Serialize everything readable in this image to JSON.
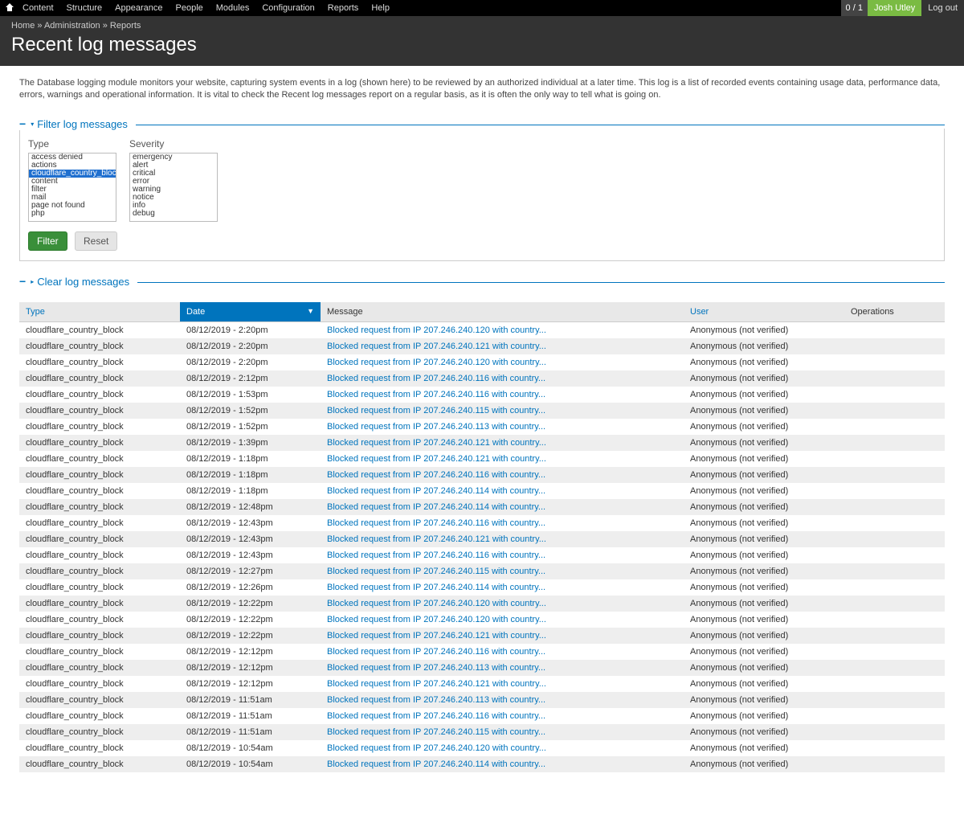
{
  "toolbar": {
    "menu": [
      "Content",
      "Structure",
      "Appearance",
      "People",
      "Modules",
      "Configuration",
      "Reports",
      "Help"
    ],
    "counter": "0 / 1",
    "user": "Josh Utley",
    "logout": "Log out"
  },
  "breadcrumb": {
    "parts": [
      "Home",
      "Administration",
      "Reports"
    ]
  },
  "page_title": "Recent log messages",
  "description": "The Database logging module monitors your website, capturing system events in a log (shown here) to be reviewed by an authorized individual at a later time. This log is a list of recorded events containing usage data, performance data, errors, warnings and operational information. It is vital to check the Recent log messages report on a regular basis, as it is often the only way to tell what is going on.",
  "filter": {
    "legend": "Filter log messages",
    "type_label": "Type",
    "severity_label": "Severity",
    "types": [
      "access denied",
      "actions",
      "cloudflare_country_block",
      "content",
      "filter",
      "mail",
      "page not found",
      "php"
    ],
    "type_selected_index": 2,
    "severities": [
      "emergency",
      "alert",
      "critical",
      "error",
      "warning",
      "notice",
      "info",
      "debug"
    ],
    "filter_btn": "Filter",
    "reset_btn": "Reset"
  },
  "clear_legend": "Clear log messages",
  "columns": {
    "type": "Type",
    "date": "Date",
    "message": "Message",
    "user": "User",
    "operations": "Operations",
    "sort_column": "date",
    "sort_dir": "desc"
  },
  "rows": [
    {
      "type": "cloudflare_country_block",
      "date": "08/12/2019 - 2:20pm",
      "msg": "Blocked request from IP 207.246.240.120 with country...",
      "user": "Anonymous (not verified)"
    },
    {
      "type": "cloudflare_country_block",
      "date": "08/12/2019 - 2:20pm",
      "msg": "Blocked request from IP 207.246.240.121 with country...",
      "user": "Anonymous (not verified)"
    },
    {
      "type": "cloudflare_country_block",
      "date": "08/12/2019 - 2:20pm",
      "msg": "Blocked request from IP 207.246.240.120 with country...",
      "user": "Anonymous (not verified)"
    },
    {
      "type": "cloudflare_country_block",
      "date": "08/12/2019 - 2:12pm",
      "msg": "Blocked request from IP 207.246.240.116 with country...",
      "user": "Anonymous (not verified)"
    },
    {
      "type": "cloudflare_country_block",
      "date": "08/12/2019 - 1:53pm",
      "msg": "Blocked request from IP 207.246.240.116 with country...",
      "user": "Anonymous (not verified)"
    },
    {
      "type": "cloudflare_country_block",
      "date": "08/12/2019 - 1:52pm",
      "msg": "Blocked request from IP 207.246.240.115 with country...",
      "user": "Anonymous (not verified)"
    },
    {
      "type": "cloudflare_country_block",
      "date": "08/12/2019 - 1:52pm",
      "msg": "Blocked request from IP 207.246.240.113 with country...",
      "user": "Anonymous (not verified)"
    },
    {
      "type": "cloudflare_country_block",
      "date": "08/12/2019 - 1:39pm",
      "msg": "Blocked request from IP 207.246.240.121 with country...",
      "user": "Anonymous (not verified)"
    },
    {
      "type": "cloudflare_country_block",
      "date": "08/12/2019 - 1:18pm",
      "msg": "Blocked request from IP 207.246.240.121 with country...",
      "user": "Anonymous (not verified)"
    },
    {
      "type": "cloudflare_country_block",
      "date": "08/12/2019 - 1:18pm",
      "msg": "Blocked request from IP 207.246.240.116 with country...",
      "user": "Anonymous (not verified)"
    },
    {
      "type": "cloudflare_country_block",
      "date": "08/12/2019 - 1:18pm",
      "msg": "Blocked request from IP 207.246.240.114 with country...",
      "user": "Anonymous (not verified)"
    },
    {
      "type": "cloudflare_country_block",
      "date": "08/12/2019 - 12:48pm",
      "msg": "Blocked request from IP 207.246.240.114 with country...",
      "user": "Anonymous (not verified)"
    },
    {
      "type": "cloudflare_country_block",
      "date": "08/12/2019 - 12:43pm",
      "msg": "Blocked request from IP 207.246.240.116 with country...",
      "user": "Anonymous (not verified)"
    },
    {
      "type": "cloudflare_country_block",
      "date": "08/12/2019 - 12:43pm",
      "msg": "Blocked request from IP 207.246.240.121 with country...",
      "user": "Anonymous (not verified)"
    },
    {
      "type": "cloudflare_country_block",
      "date": "08/12/2019 - 12:43pm",
      "msg": "Blocked request from IP 207.246.240.116 with country...",
      "user": "Anonymous (not verified)"
    },
    {
      "type": "cloudflare_country_block",
      "date": "08/12/2019 - 12:27pm",
      "msg": "Blocked request from IP 207.246.240.115 with country...",
      "user": "Anonymous (not verified)"
    },
    {
      "type": "cloudflare_country_block",
      "date": "08/12/2019 - 12:26pm",
      "msg": "Blocked request from IP 207.246.240.114 with country...",
      "user": "Anonymous (not verified)"
    },
    {
      "type": "cloudflare_country_block",
      "date": "08/12/2019 - 12:22pm",
      "msg": "Blocked request from IP 207.246.240.120 with country...",
      "user": "Anonymous (not verified)"
    },
    {
      "type": "cloudflare_country_block",
      "date": "08/12/2019 - 12:22pm",
      "msg": "Blocked request from IP 207.246.240.120 with country...",
      "user": "Anonymous (not verified)"
    },
    {
      "type": "cloudflare_country_block",
      "date": "08/12/2019 - 12:22pm",
      "msg": "Blocked request from IP 207.246.240.121 with country...",
      "user": "Anonymous (not verified)"
    },
    {
      "type": "cloudflare_country_block",
      "date": "08/12/2019 - 12:12pm",
      "msg": "Blocked request from IP 207.246.240.116 with country...",
      "user": "Anonymous (not verified)"
    },
    {
      "type": "cloudflare_country_block",
      "date": "08/12/2019 - 12:12pm",
      "msg": "Blocked request from IP 207.246.240.113 with country...",
      "user": "Anonymous (not verified)"
    },
    {
      "type": "cloudflare_country_block",
      "date": "08/12/2019 - 12:12pm",
      "msg": "Blocked request from IP 207.246.240.121 with country...",
      "user": "Anonymous (not verified)"
    },
    {
      "type": "cloudflare_country_block",
      "date": "08/12/2019 - 11:51am",
      "msg": "Blocked request from IP 207.246.240.113 with country...",
      "user": "Anonymous (not verified)"
    },
    {
      "type": "cloudflare_country_block",
      "date": "08/12/2019 - 11:51am",
      "msg": "Blocked request from IP 207.246.240.116 with country...",
      "user": "Anonymous (not verified)"
    },
    {
      "type": "cloudflare_country_block",
      "date": "08/12/2019 - 11:51am",
      "msg": "Blocked request from IP 207.246.240.115 with country...",
      "user": "Anonymous (not verified)"
    },
    {
      "type": "cloudflare_country_block",
      "date": "08/12/2019 - 10:54am",
      "msg": "Blocked request from IP 207.246.240.120 with country...",
      "user": "Anonymous (not verified)"
    },
    {
      "type": "cloudflare_country_block",
      "date": "08/12/2019 - 10:54am",
      "msg": "Blocked request from IP 207.246.240.114 with country...",
      "user": "Anonymous (not verified)"
    }
  ]
}
